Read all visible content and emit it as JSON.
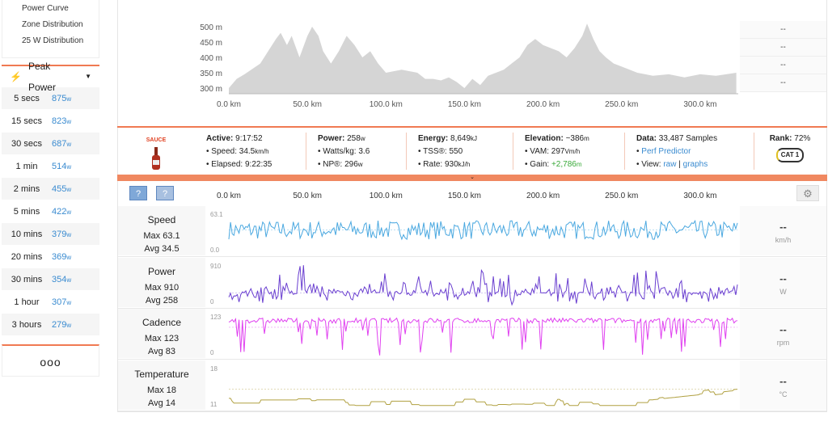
{
  "sidebar": {
    "menu": [
      "Power Curve",
      "Zone Distribution",
      "25 W Distribution"
    ],
    "peak_title": "Peak Power",
    "unit": "w",
    "peaks": [
      [
        "5 secs",
        "875"
      ],
      [
        "15 secs",
        "823"
      ],
      [
        "30 secs",
        "687"
      ],
      [
        "1 min",
        "514"
      ],
      [
        "2 mins",
        "455"
      ],
      [
        "5 mins",
        "422"
      ],
      [
        "10 mins",
        "379"
      ],
      [
        "20 mins",
        "369"
      ],
      [
        "30 mins",
        "354"
      ],
      [
        "1 hour",
        "307"
      ],
      [
        "3 hours",
        "279"
      ]
    ],
    "more": "ooo"
  },
  "elevation": {
    "y_ticks": [
      "500 m",
      "450 m",
      "400 m",
      "350 m",
      "300 m"
    ],
    "x_ticks": [
      "0.0 km",
      "50.0 km",
      "100.0 km",
      "150.0 km",
      "200.0 km",
      "250.0 km",
      "300.0 km"
    ],
    "side_values": [
      "--",
      "--",
      "--",
      "--"
    ],
    "profile_km": [
      0,
      5,
      10,
      20,
      25,
      30,
      33,
      37,
      40,
      45,
      50,
      53,
      57,
      60,
      65,
      70,
      75,
      80,
      85,
      90,
      95,
      100,
      110,
      120,
      125,
      130,
      135,
      140,
      145,
      150,
      155,
      160,
      165,
      170,
      175,
      180,
      185,
      190,
      195,
      200,
      210,
      215,
      220,
      225,
      228,
      232,
      236,
      240,
      245,
      250,
      260,
      270,
      280,
      290,
      300,
      310,
      323
    ],
    "profile_m": [
      300,
      330,
      345,
      380,
      420,
      460,
      480,
      440,
      470,
      400,
      470,
      500,
      470,
      420,
      380,
      420,
      470,
      440,
      400,
      420,
      380,
      350,
      360,
      350,
      330,
      330,
      325,
      335,
      320,
      300,
      330,
      310,
      340,
      350,
      360,
      380,
      400,
      440,
      460,
      440,
      420,
      400,
      430,
      470,
      510,
      460,
      420,
      400,
      380,
      370,
      350,
      340,
      345,
      335,
      345,
      340,
      350
    ]
  },
  "stats": {
    "logo": "SAUCE",
    "active": {
      "label": "Active:",
      "value": "9:17:52",
      "speed_label": "Speed:",
      "speed": "34.5",
      "speed_unit": "km/h",
      "elapsed_label": "Elapsed:",
      "elapsed": "9:22:35"
    },
    "power": {
      "label": "Power:",
      "value": "258",
      "unit": "w",
      "wkg_label": "Watts/kg:",
      "wkg": "3.6",
      "np_label": "NP®:",
      "np": "296",
      "np_unit": "w"
    },
    "energy": {
      "label": "Energy:",
      "value": "8,649",
      "unit": "kJ",
      "tss_label": "TSS®:",
      "tss": "550",
      "rate_label": "Rate:",
      "rate": "930",
      "rate_unit": "kJ/h"
    },
    "elevation": {
      "label": "Elevation:",
      "value": "~386",
      "unit": "m",
      "vam_label": "VAM:",
      "vam": "297",
      "vam_unit": "Vm/h",
      "gain_label": "Gain:",
      "gain": "+2,786",
      "gain_unit": "m"
    },
    "data": {
      "label": "Data:",
      "value": "33,487 Samples",
      "perf": "Perf Predictor",
      "view_label": "View:",
      "raw": "raw",
      "sep": "|",
      "graphs": "graphs"
    },
    "rank": {
      "label": "Rank:",
      "value": "72%",
      "badge": "CAT 1"
    }
  },
  "toolbar": {
    "help1": "?",
    "help2": "?",
    "x_ticks": [
      "0.0 km",
      "50.0 km",
      "100.0 km",
      "150.0 km",
      "200.0 km",
      "250.0 km",
      "300.0 km"
    ]
  },
  "streams": [
    {
      "name": "Speed",
      "max": "Max 63.1",
      "avg": "Avg 34.5",
      "ytop": "63.1",
      "ybot": "0.0",
      "value": "--",
      "unit": "km/h",
      "color": "#4aa8e0",
      "vmax": 63.1,
      "vavg": 34.5
    },
    {
      "name": "Power",
      "max": "Max 910",
      "avg": "Avg 258",
      "ytop": "910",
      "ybot": "0",
      "value": "--",
      "unit": "W",
      "color": "#6a3fd0",
      "vmax": 910,
      "vavg": 258
    },
    {
      "name": "Cadence",
      "max": "Max 123",
      "avg": "Avg 83",
      "ytop": "123",
      "ybot": "0",
      "value": "--",
      "unit": "rpm",
      "color": "#e040f0",
      "vmax": 123,
      "vavg": 83
    },
    {
      "name": "Temperature",
      "max": "Max 18",
      "avg": "Avg 14",
      "ytop": "18",
      "ybot": "11",
      "value": "--",
      "unit": "°C",
      "color": "#b0a040",
      "vmax": 18,
      "vavg": 14
    }
  ]
}
